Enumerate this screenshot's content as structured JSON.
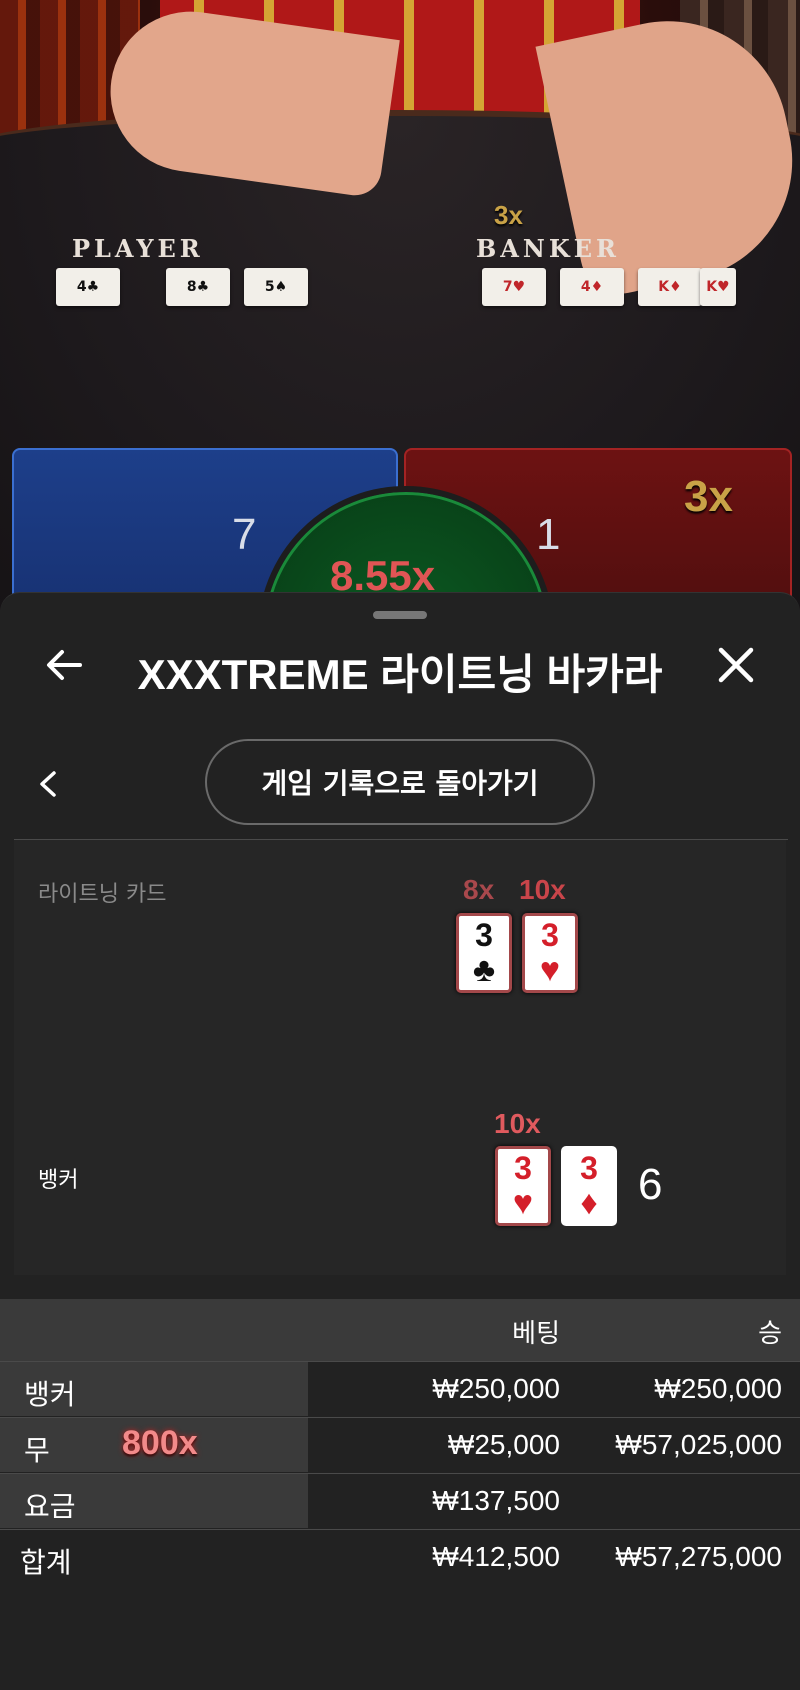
{
  "video": {
    "player_label": "PLAYER",
    "banker_label": "BANKER",
    "banker_multiplier": "3x",
    "player_cards": [
      "4♣",
      "8♣",
      "5♠"
    ],
    "banker_cards": [
      "7♥",
      "4♦",
      "K♦",
      "K♥"
    ],
    "spot_player_value": "7",
    "spot_banker_value": "1",
    "spot_banker_multiplier": "3x",
    "tie_multiplier": "8.55x"
  },
  "header": {
    "title": "XXXTREME 라이트닝 바카라",
    "back_to_history": "게임 기록으로 돌아가기"
  },
  "result": {
    "lightning_label": "라이트닝 카드",
    "lightning_cards": [
      {
        "rank": "3",
        "suit": "♣",
        "color": "black",
        "multiplier": "8x"
      },
      {
        "rank": "3",
        "suit": "♥",
        "color": "red",
        "multiplier": "10x"
      }
    ],
    "banker_label": "뱅커",
    "banker_cards": [
      {
        "rank": "3",
        "suit": "♥",
        "color": "red",
        "multiplier": "10x"
      },
      {
        "rank": "3",
        "suit": "♦",
        "color": "red",
        "multiplier": ""
      }
    ],
    "banker_score": "6"
  },
  "bets": {
    "col_bet": "베팅",
    "col_win": "승",
    "rows": [
      {
        "name": "뱅커",
        "badge": "",
        "bet": "₩250,000",
        "win": "₩250,000"
      },
      {
        "name": "무",
        "badge": "800x",
        "bet": "₩25,000",
        "win": "₩57,025,000"
      },
      {
        "name": "요금",
        "badge": "",
        "bet": "₩137,500",
        "win": ""
      }
    ],
    "total": {
      "name": "합계",
      "bet": "₩412,500",
      "win": "₩57,275,000"
    }
  },
  "colors": {
    "sheet_bg": "#222222",
    "player_blue": "#1d3f8a",
    "banker_red": "#6d1212",
    "gold": "#c9a247",
    "lightning_red": "#d41f2a"
  }
}
